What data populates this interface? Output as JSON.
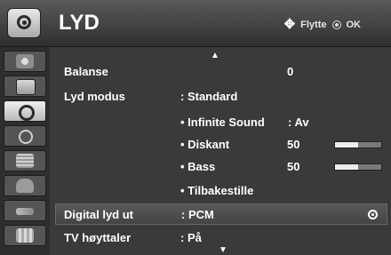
{
  "header": {
    "title": "LYD",
    "hint_move": "Flytte",
    "hint_ok": "OK"
  },
  "sidebar": {
    "items": [
      "picture-icon",
      "tv-icon",
      "sound-icon",
      "time-icon",
      "option-icon",
      "lock-icon",
      "input-icon",
      "usb-icon"
    ],
    "active": 2
  },
  "menu": {
    "balanse": {
      "label": "Balanse",
      "value": "0"
    },
    "lyd_modus": {
      "label": "Lyd modus",
      "value": ": Standard"
    },
    "infinite_sound": {
      "label": "• Infinite Sound",
      "value": ": Av"
    },
    "diskant": {
      "label": "• Diskant",
      "value": "50",
      "level": 0.5
    },
    "bass": {
      "label": "• Bass",
      "value": "50",
      "level": 0.5
    },
    "tilbakestille": {
      "label": "• Tilbakestille"
    },
    "digital_lyd_ut": {
      "label": "Digital lyd ut",
      "value": ": PCM"
    },
    "tv_hoyttaler": {
      "label": "TV høyttaler",
      "value": ": På"
    }
  },
  "colors": {
    "background": "#3a3a3a",
    "highlight": "#555555",
    "text": "#ffffff"
  }
}
